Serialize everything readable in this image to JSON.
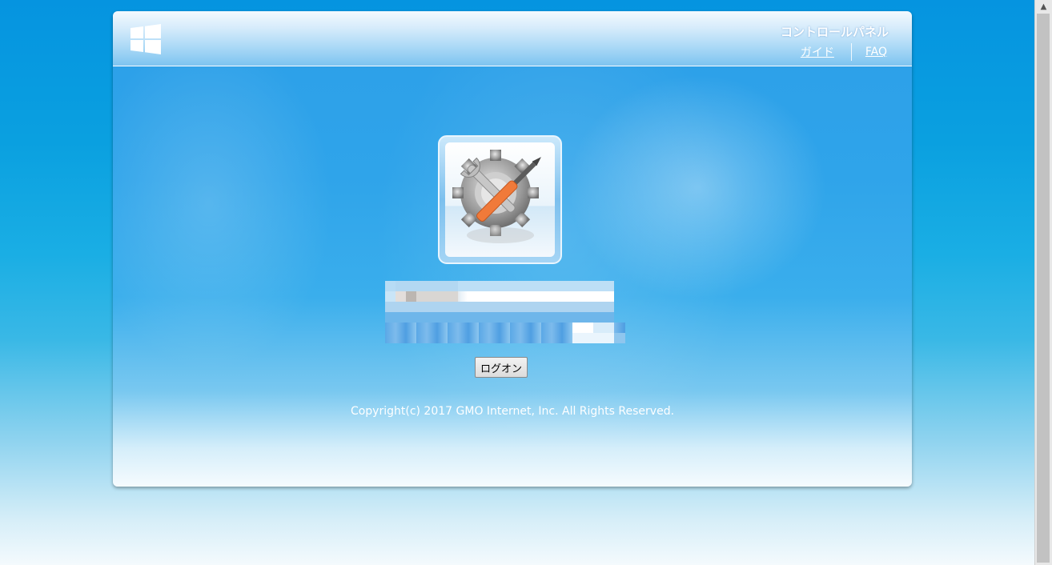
{
  "header": {
    "title": "コントロールパネル",
    "links": [
      {
        "label": "ガイド"
      },
      {
        "label": "FAQ"
      }
    ]
  },
  "icons": {
    "logo": "windows-logo-icon",
    "app": "gear-wrench-tools-icon"
  },
  "login": {
    "username_value": "",
    "password_value": "",
    "submit_label": "ログオン"
  },
  "footer": {
    "copyright": "Copyright(c) 2017 GMO Internet, Inc. All Rights Reserved."
  },
  "colors": {
    "background_top": "#0594e0",
    "panel_blue": "#2fa4ea",
    "link_color": "#ffffff"
  }
}
